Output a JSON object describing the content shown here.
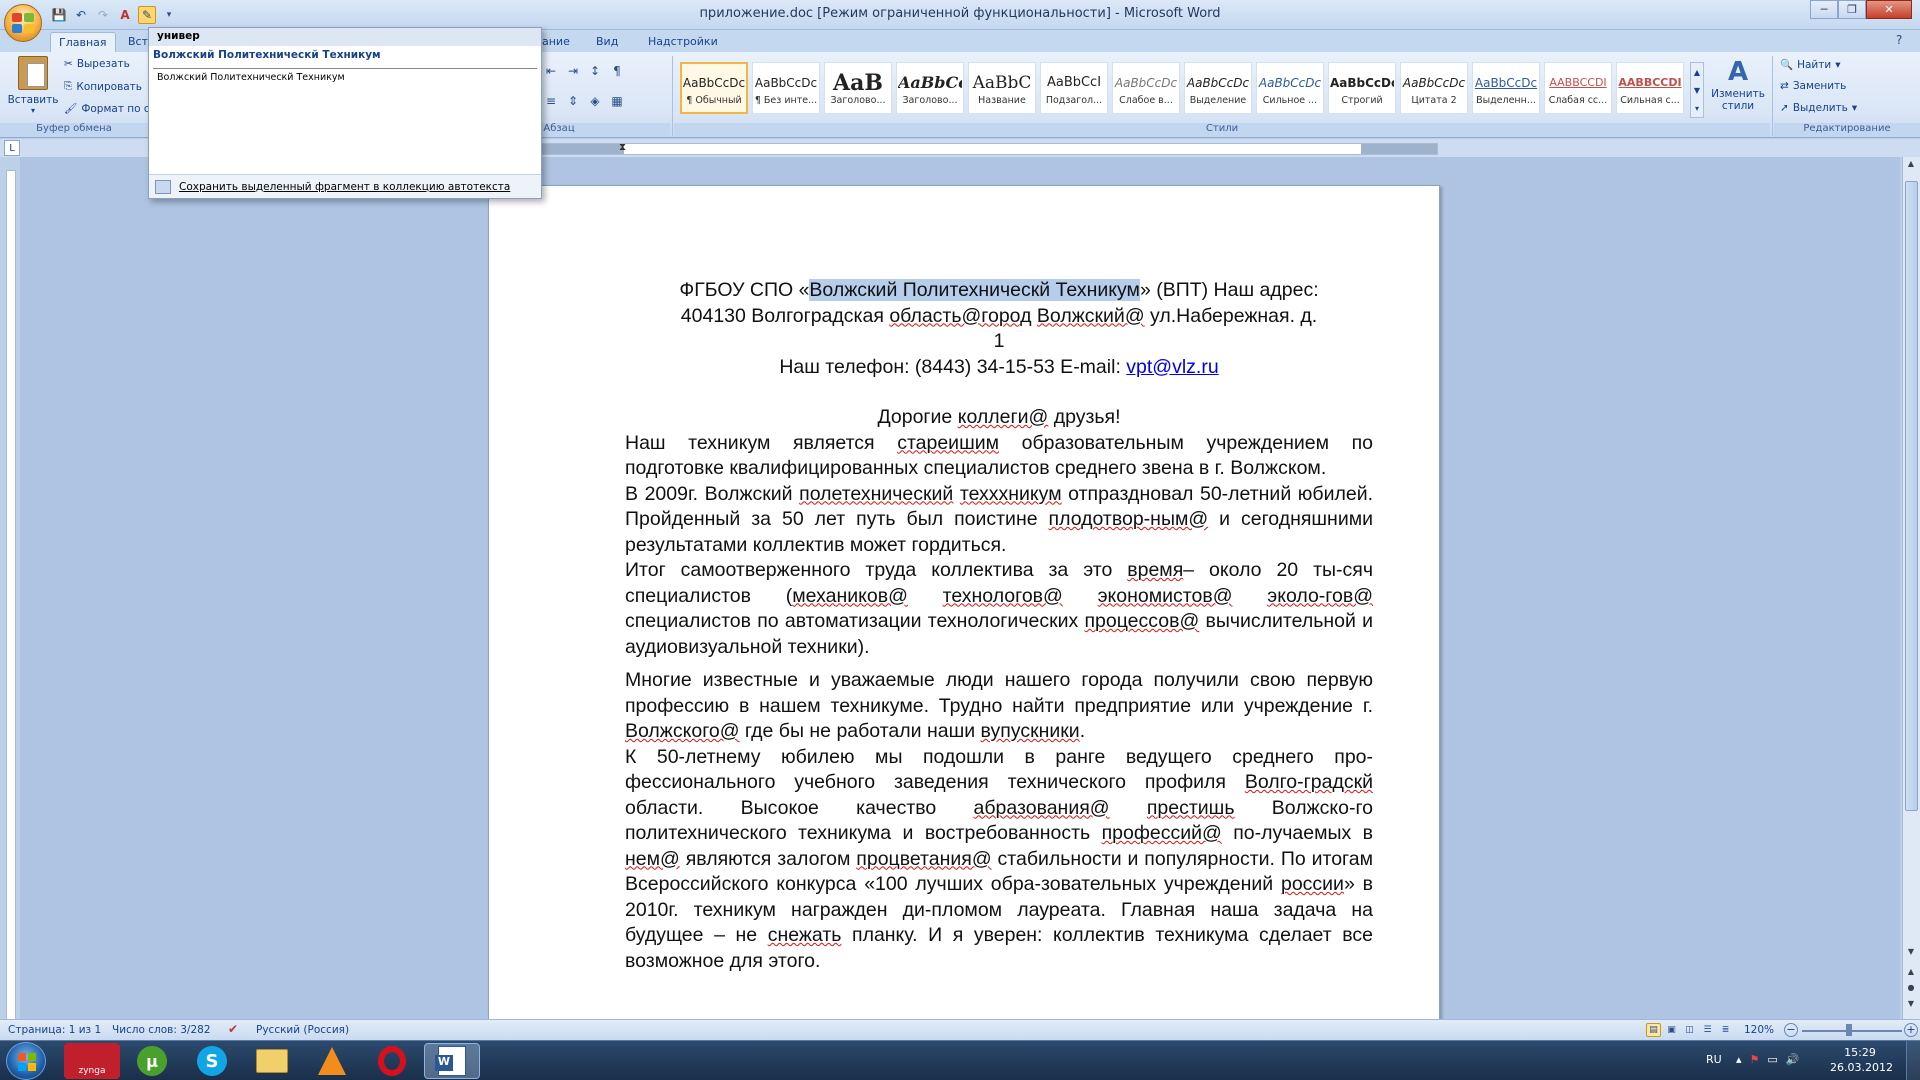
{
  "window": {
    "title": "приложение.doc [Режим ограниченной функциональности] - Microsoft Word"
  },
  "tabs": [
    "Главная",
    "Вст",
    "ание",
    "Вид",
    "Надстройки"
  ],
  "clipboard": {
    "paste": "Вставить",
    "cut": "Вырезать",
    "copy": "Копировать",
    "format": "Формат по о",
    "group": "Буфер обмена"
  },
  "paragraph": {
    "group": "Абзац"
  },
  "styles": {
    "group": "Стили",
    "items": [
      {
        "preview": "AaBbCcDc",
        "name": "¶ Обычный"
      },
      {
        "preview": "AaBbCcDc",
        "name": "¶ Без инте..."
      },
      {
        "preview": "AaB",
        "name": "Заголово..."
      },
      {
        "preview": "AaBbCc",
        "name": "Заголово..."
      },
      {
        "preview": "AaBbC",
        "name": "Название"
      },
      {
        "preview": "AaBbCcI",
        "name": "Подзагол..."
      },
      {
        "preview": "AaBbCcDc",
        "name": "Слабое в..."
      },
      {
        "preview": "AaBbCcDc",
        "name": "Выделение"
      },
      {
        "preview": "AaBbCcDc",
        "name": "Сильное ..."
      },
      {
        "preview": "AaBbCcDc",
        "name": "Строгий"
      },
      {
        "preview": "AaBbCcDc",
        "name": "Цитата 2"
      },
      {
        "preview": "AaBbCcDc",
        "name": "Выделенн..."
      },
      {
        "preview": "AABBCCDI",
        "name": "Слабая сс..."
      },
      {
        "preview": "AABBCCDI",
        "name": "Сильная с..."
      }
    ],
    "change": "Изменить стили"
  },
  "editing": {
    "find": "Найти",
    "replace": "Заменить",
    "select": "Выделить",
    "group": "Редактирование"
  },
  "autotext": {
    "header": "универ",
    "entry_title": "Волжский Политехническй Техникум",
    "entry_preview": "Волжский Политехническй Техникум",
    "footer": "Сохранить выделенный фрагмент в коллекцию автотекста"
  },
  "document": {
    "line1_a": "ФГБОУ СПО «",
    "line1_sel": "Волжский Политехническй Техникум",
    "line1_b": "» (ВПТ) Наш адрес:",
    "line2_a": "404130 Волгоградская ",
    "line2_w1": "область@город",
    "line2_sp": " ",
    "line2_w2": "Волжский@",
    "line2_b": " ул.Набережная. д.",
    "line3": "1",
    "phone": "Наш телефон: (8443) 34-15-53 E-mail: ",
    "email": "vpt@vlz.ru",
    "greet_a": "Дорогие ",
    "greet_w": "коллеги@",
    "greet_b": " друзья!",
    "p1_a": "Наш техникум является ",
    "p1_w": "стареишим",
    "p1_b": " образовательным учреждением по подготовке квалифицированных специалистов среднего звена в г. Волжском.",
    "p2_a": "В 2009г. Волжский ",
    "p2_w1": "полетехнический",
    "p2_sp": " ",
    "p2_w2": "техххникум",
    "p2_b": " отпраздновал 50-летний юбилей. Пройденный за 50 лет путь был поистине ",
    "p2_w3": "плодотвор-ным@",
    "p2_c": " и сегодняшними результатами коллектив может гордиться.",
    "p3_a": "Итог самоотверженного труда коллектива за это ",
    "p3_w1": "время",
    "p3_b": "– около 20 ты-сяч специалистов (",
    "p3_w2": "механиков@",
    "p3_w3": "технологов@",
    "p3_w4": "экономистов@",
    "p3_w5": "эколо-гов@",
    "p3_c": " специалистов по автоматизации технологических ",
    "p3_w6": "процессов@",
    "p3_d": " вычислительной и аудиовизуальной техники).",
    "p4_a": "Многие известные и уважаемые люди нашего города получили свою первую профессию в нашем техникуме. Трудно найти предприятие или учреждение г. ",
    "p4_w1": "Волжского@",
    "p4_b": " где бы не работали наши ",
    "p4_w2": "вупускники",
    "p4_c": ".",
    "p5_a": "К 50-летнему юбилею мы подошли в ранге ведущего среднего про-фессионального учебного заведения технического профиля ",
    "p5_w1": "Волго-градскй",
    "p5_b": " области. Высокое качество ",
    "p5_w2": "абразования@",
    "p5_sp": " ",
    "p5_w3": "престишь",
    "p5_c": " Волжско-го политехнического техникума и востребованность ",
    "p5_w4": "профессий@",
    "p5_d": " по-лучаемых в ",
    "p5_w5": "нем@",
    "p5_e": " являются залогом ",
    "p5_w6": "процветания@",
    "p5_f": " стабильности и популярности. По итогам Всероссийского конкурса «100 лучших обра-зовательных учреждений ",
    "p5_w7": "россии",
    "p5_g": "» в 2010г. техникум награжден ди-пломом лауреата. Главная наша задача на будущее – не ",
    "p5_w8": "снежать",
    "p5_h": " планку. И я уверен: коллектив техникума сделает все возможное для этого."
  },
  "status": {
    "page": "Страница: 1 из 1",
    "words": "Число слов: 3/282",
    "lang": "Русский (Россия)",
    "zoom": "120%"
  },
  "taskbar": {
    "lang": "RU",
    "time": "15:29",
    "date": "26.03.2012",
    "zynga": "zynga"
  },
  "colors": {
    "accent": "#15428b",
    "selection": "#b6cdeb",
    "spell": "#d11"
  }
}
